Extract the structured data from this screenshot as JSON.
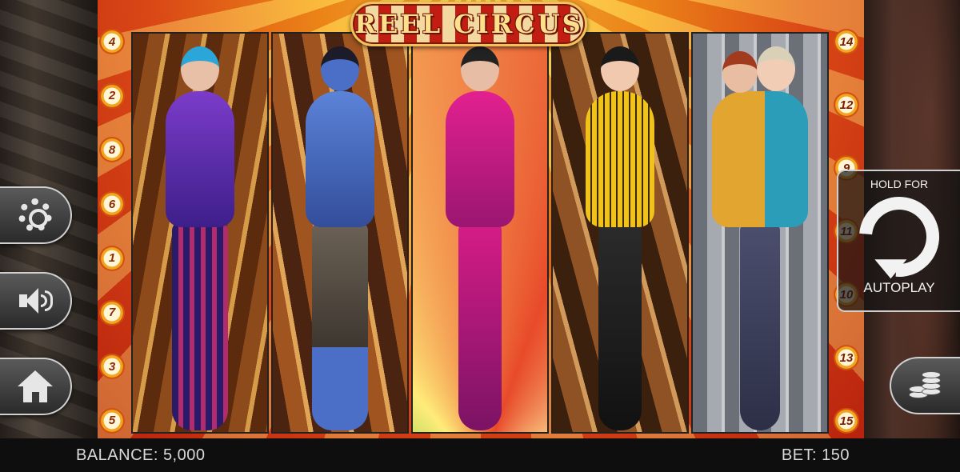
{
  "game": {
    "title": "REEL CIRCUS"
  },
  "paylines": {
    "left": [
      "4",
      "2",
      "8",
      "6",
      "1",
      "7",
      "3",
      "5"
    ],
    "right": [
      "14",
      "12",
      "9",
      "11",
      "10",
      "13",
      "15"
    ]
  },
  "controls": {
    "settings_icon": "gear-icon",
    "sound_icon": "speaker-icon",
    "home_icon": "home-icon",
    "spin": {
      "hold_label": "HOLD FOR",
      "autoplay_label": "AUTOPLAY",
      "icon": "spin-arrow-icon"
    },
    "bet_icon": "coin-stack-icon"
  },
  "reels": [
    {
      "symbol": "blue-haired ringmaster"
    },
    {
      "symbol": "blue knife thrower"
    },
    {
      "symbol": "pink contortionist"
    },
    {
      "symbol": "yellow rope acrobat"
    },
    {
      "symbol": "conjoined twins"
    }
  ],
  "status": {
    "balance_label": "BALANCE:",
    "balance_value": "5,000",
    "bet_label": "BET:",
    "bet_value": "150"
  }
}
